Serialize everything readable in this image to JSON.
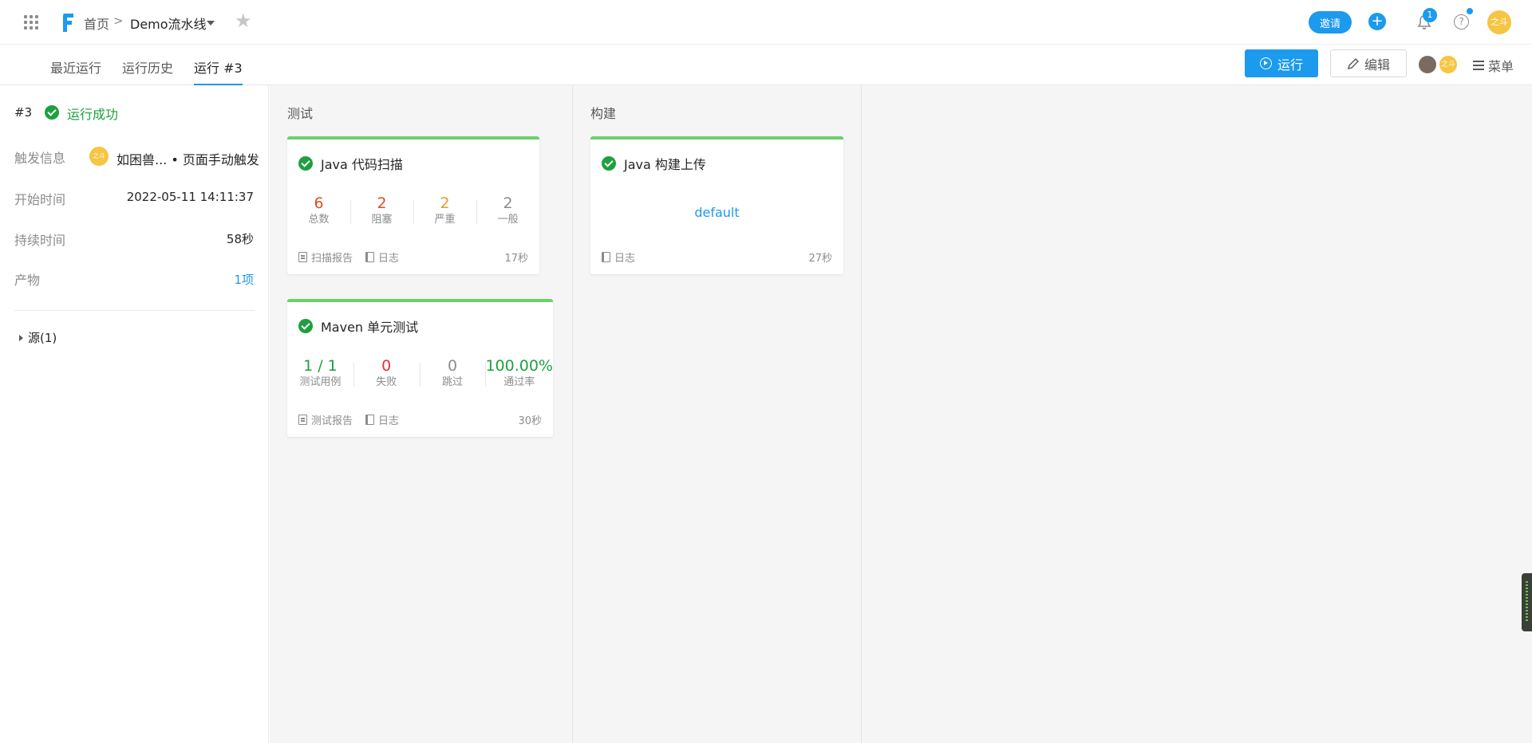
{
  "header": {
    "breadcrumb_home": "首页",
    "breadcrumb_sep": ">",
    "pipeline_name": "Demo流水线",
    "invite_label": "邀请",
    "plus_label": "+",
    "notification_count": "1",
    "help_label": "?",
    "user_avatar_text": "之斗"
  },
  "tabs": {
    "recent": "最近运行",
    "history": "运行历史",
    "current": "运行 #3"
  },
  "toolbar": {
    "run_label": "运行",
    "edit_label": "编辑",
    "member_avatar_text": "之斗",
    "menu_label": "菜单"
  },
  "run_info": {
    "number": "#3",
    "status": "运行成功",
    "trigger_label": "触发信息",
    "trigger_avatar_text": "之斗",
    "trigger_value": "如困兽... • 页面手动触发",
    "start_label": "开始时间",
    "start_value": "2022-05-11 14:11:37",
    "duration_label": "持续时间",
    "duration_value": "58秒",
    "artifact_label": "产物",
    "artifact_value": "1项",
    "source_label": "源(1)"
  },
  "stages": [
    {
      "title": "测试",
      "jobs": [
        {
          "name": "Java 代码扫描",
          "metrics": [
            {
              "value": "6",
              "label": "总数"
            },
            {
              "value": "2",
              "label": "阻塞"
            },
            {
              "value": "2",
              "label": "严重"
            },
            {
              "value": "2",
              "label": "一般"
            }
          ],
          "report_label": "扫描报告",
          "log_label": "日志",
          "time": "17秒"
        },
        {
          "name": "Maven 单元测试",
          "metrics": [
            {
              "value": "1 / 1",
              "label": "测试用例"
            },
            {
              "value": "0",
              "label": "失败"
            },
            {
              "value": "0",
              "label": "跳过"
            },
            {
              "value": "100.00%",
              "label": "通过率"
            }
          ],
          "report_label": "测试报告",
          "log_label": "日志",
          "time": "30秒"
        }
      ]
    },
    {
      "title": "构建",
      "jobs": [
        {
          "name": "Java 构建上传",
          "default_label": "default",
          "log_label": "日志",
          "time": "27秒"
        }
      ]
    }
  ],
  "colors": {
    "accent": "#1b9aee",
    "success": "#1ea03e",
    "card_top": "#6cd06c"
  }
}
